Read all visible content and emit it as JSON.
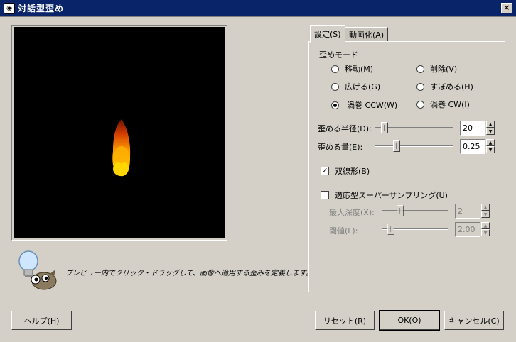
{
  "window": {
    "title": "対話型歪め",
    "close_label": "×"
  },
  "hint": "プレビュー内でクリック・ドラッグして、画像へ適用する歪みを定義します。",
  "tabs": [
    {
      "label": "設定(S)",
      "active": true
    },
    {
      "label": "動画化(A)",
      "active": false
    }
  ],
  "mode": {
    "title": "歪めモード",
    "options": [
      {
        "label": "移動(M)",
        "checked": false
      },
      {
        "label": "削除(V)",
        "checked": false
      },
      {
        "label": "広げる(G)",
        "checked": false
      },
      {
        "label": "すぼめる(H)",
        "checked": false
      },
      {
        "label": "渦巻 CCW(W)",
        "checked": true
      },
      {
        "label": "渦巻 CW(I)",
        "checked": false
      }
    ]
  },
  "radius": {
    "label": "歪める半径(D):",
    "value": "20",
    "level": 0.08
  },
  "amount": {
    "label": "歪める量(E):",
    "value": "0.25",
    "level": 0.25
  },
  "bilinear": {
    "label": "双線形(B)",
    "checked": true,
    "mark": "✓"
  },
  "supersample": {
    "label": "適応型スーパーサンプリング(U)",
    "checked": false
  },
  "max_depth": {
    "label": "最大深度(X):",
    "value": "2",
    "level": 0.25
  },
  "threshold": {
    "label": "閾値(L):",
    "value": "2.00",
    "level": 0.1
  },
  "buttons": {
    "help": "ヘルプ(H)",
    "reset": "リセット(R)",
    "ok": "OK(O)",
    "cancel": "キャンセル(C)"
  },
  "colors": {
    "titlebar": "#0a246a",
    "face": "#d4d0c8",
    "flame_top": "#8b1a00",
    "flame_mid": "#ff8a00",
    "flame_bottom": "#ffe000"
  },
  "icons": {
    "title": "gimp-icon",
    "hint": "lightbulb-wilber-icon"
  }
}
